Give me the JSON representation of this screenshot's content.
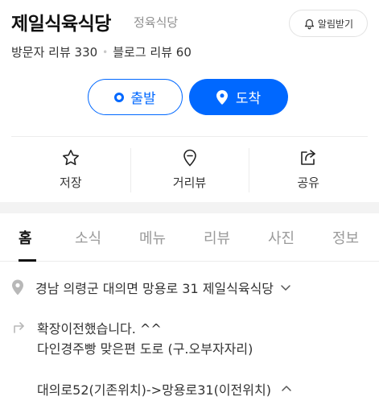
{
  "place": {
    "name": "제일식육식당",
    "category": "정육식당",
    "alarm_label": "알림받기"
  },
  "reviews": {
    "visitor": "방문자 리뷰 330",
    "blog": "블로그 리뷰 60"
  },
  "route": {
    "depart_label": "출발",
    "arrive_label": "도착"
  },
  "actions": [
    {
      "label": "저장",
      "icon": "star-icon"
    },
    {
      "label": "거리뷰",
      "icon": "street-view-icon"
    },
    {
      "label": "공유",
      "icon": "share-icon"
    }
  ],
  "tabs": [
    {
      "label": "홈",
      "active": true
    },
    {
      "label": "소식",
      "active": false
    },
    {
      "label": "메뉴",
      "active": false
    },
    {
      "label": "리뷰",
      "active": false
    },
    {
      "label": "사진",
      "active": false
    },
    {
      "label": "정보",
      "active": false
    }
  ],
  "info": {
    "address": "경남 의령군 대의면 망용로 31 제일식육식당",
    "directions_line1": "확장이전했습니다. ^^",
    "directions_line2": "다인경주빵 맞은편 도로 (구.오부자자리)",
    "directions_line3": "대의로52(기존위치)->망용로31(이전위치)"
  },
  "colors": {
    "accent": "#0068ff",
    "text": "#333333",
    "muted": "#9a9a9a"
  }
}
